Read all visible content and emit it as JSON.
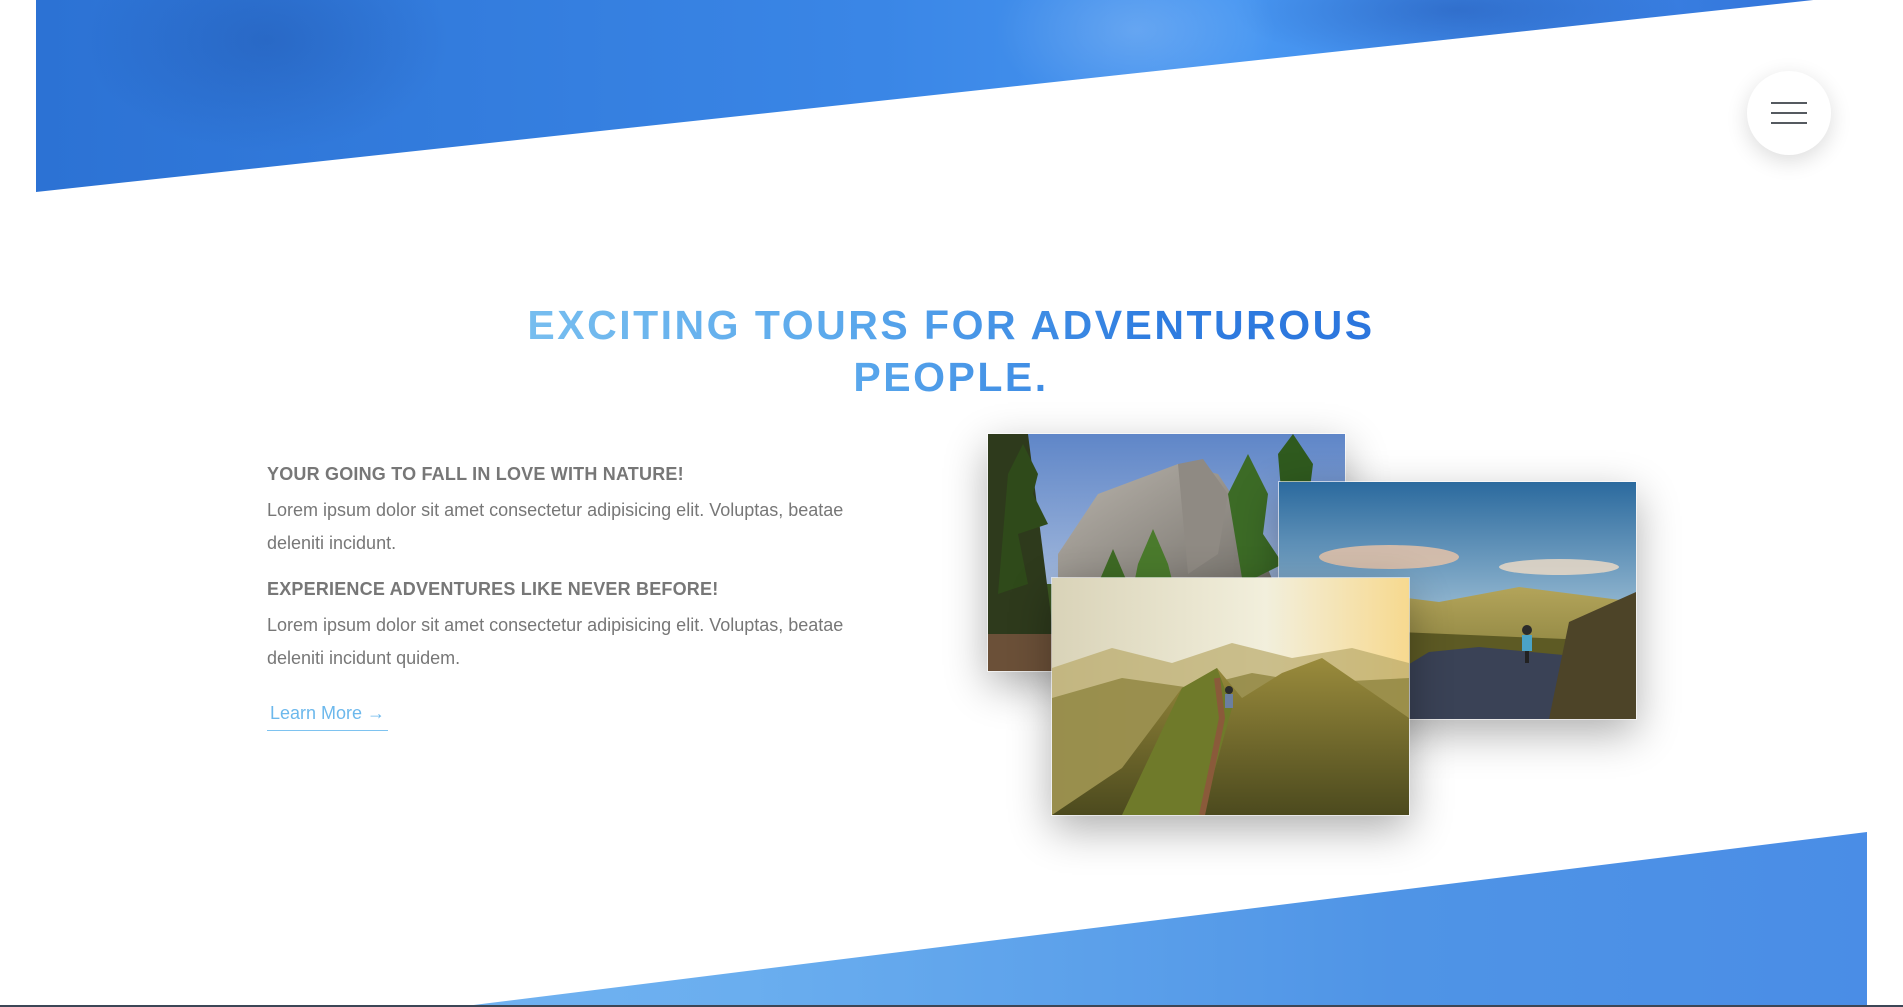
{
  "navigation": {
    "menu_icon": "hamburger-menu-icon"
  },
  "section": {
    "title": "EXCITING TOURS FOR ADVENTUROUS PEOPLE."
  },
  "features": [
    {
      "heading": "YOUR GOING TO FALL IN LOVE WITH NATURE!",
      "text": "Lorem ipsum dolor sit amet consectetur adipisicing elit. Voluptas, beatae deleniti incidunt."
    },
    {
      "heading": "EXPERIENCE ADVENTURES LIKE NEVER BEFORE!",
      "text": "Lorem ipsum dolor sit amet consectetur adipisicing elit. Voluptas, beatae deleniti incidunt quidem."
    }
  ],
  "cta": {
    "label": "Learn More →"
  },
  "photos": [
    {
      "id": "photo-1",
      "subject": "forest-cliffs-photo"
    },
    {
      "id": "photo-2",
      "subject": "cyclist-road-photo"
    },
    {
      "id": "photo-3",
      "subject": "mountain-ridge-hiker-photo"
    }
  ],
  "colors": {
    "primary_blue": "#2f7de0",
    "light_blue": "#7ec3f0",
    "text_gray": "#777777"
  }
}
